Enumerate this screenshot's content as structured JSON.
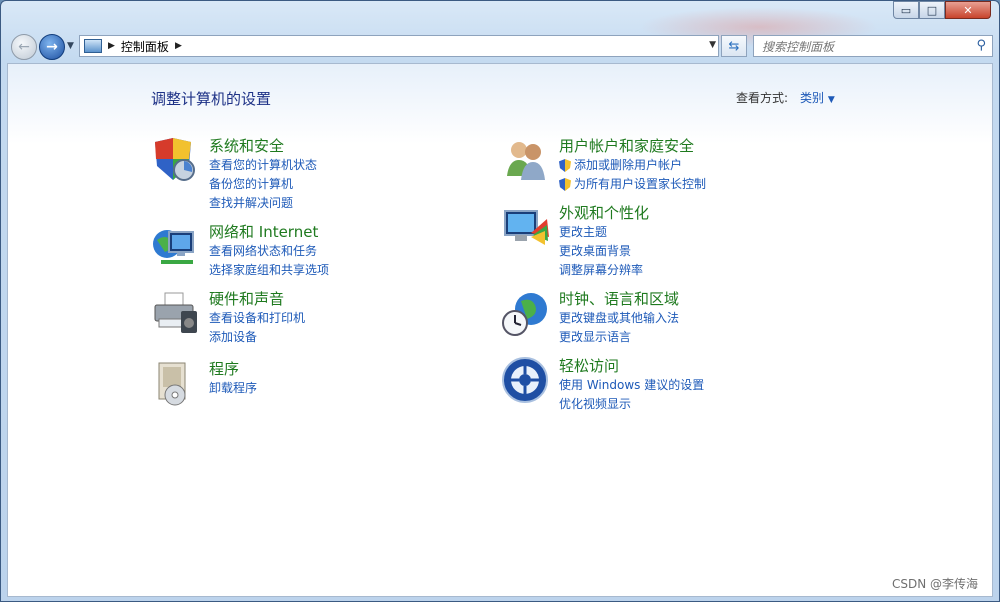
{
  "window": {
    "caption_buttons": {
      "minimize": "▭",
      "maximize": "□",
      "close": "✕"
    }
  },
  "toolbar": {
    "breadcrumb": "控制面板",
    "search_placeholder": "搜索控制面板"
  },
  "main": {
    "title": "调整计算机的设置",
    "view_by_label": "查看方式:",
    "view_by_value": "类别",
    "categories": [
      {
        "title": "系统和安全",
        "icon": "shield-icon",
        "links": [
          "查看您的计算机状态",
          "备份您的计算机",
          "查找并解决问题"
        ]
      },
      {
        "title": "网络和 Internet",
        "icon": "network-icon",
        "links": [
          "查看网络状态和任务",
          "选择家庭组和共享选项"
        ]
      },
      {
        "title": "硬件和声音",
        "icon": "printer-icon",
        "links": [
          "查看设备和打印机",
          "添加设备"
        ]
      },
      {
        "title": "程序",
        "icon": "programs-icon",
        "links": [
          "卸载程序"
        ]
      },
      {
        "title": "用户帐户和家庭安全",
        "icon": "users-icon",
        "links": [
          "添加或删除用户帐户",
          "为所有用户设置家长控制"
        ]
      },
      {
        "title": "外观和个性化",
        "icon": "display-icon",
        "links": [
          "更改主题",
          "更改桌面背景",
          "调整屏幕分辨率"
        ]
      },
      {
        "title": "时钟、语言和区域",
        "icon": "globe-clock-icon",
        "links": [
          "更改键盘或其他输入法",
          "更改显示语言"
        ]
      },
      {
        "title": "轻松访问",
        "icon": "accessibility-icon",
        "links": [
          "使用 Windows 建议的设置",
          "优化视频显示"
        ]
      }
    ]
  },
  "watermark": "CSDN @李传海",
  "colors": {
    "category_title": "#1f7a1f",
    "link": "#1e5ab8",
    "heading": "#1e3287"
  }
}
